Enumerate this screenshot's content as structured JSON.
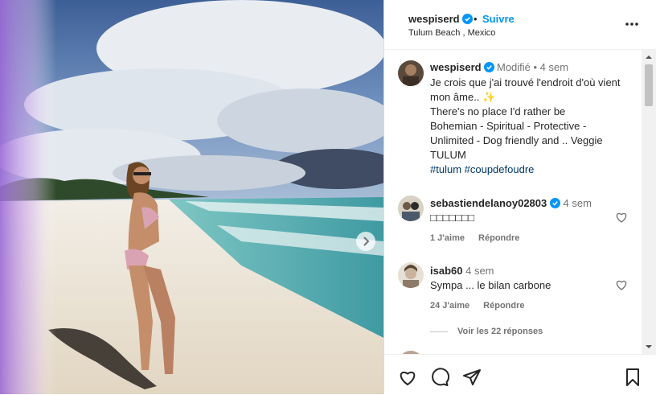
{
  "header": {
    "username": "wespiserd",
    "separator": "•",
    "follow_label": "Suivre",
    "location": "Tulum Beach , Mexico"
  },
  "caption": {
    "username": "wespiserd",
    "meta": "Modifié • 4 sem",
    "line1": "Je crois que j'ai trouvé l'endroit d'où vient mon âme.. ✨",
    "line2": "There's no place I'd rather be",
    "line3": "Bohemian - Spiritual - Protective - Unlimited - Dog friendly and .. Veggie TULUM",
    "hashtags": "#tulum #coupdefoudre"
  },
  "comments": [
    {
      "username": "sebastiendelanoy02803",
      "time": "4 sem",
      "text": "□□□□□□□",
      "likes": "1 J'aime",
      "reply_label": "Répondre"
    },
    {
      "username": "isab60",
      "time": "4 sem",
      "text": "Sympa ... le bilan carbone",
      "likes": "24 J'aime",
      "reply_label": "Répondre"
    }
  ],
  "view_replies_label": "Voir les 22 réponses",
  "colors": {
    "accent": "#0095f6",
    "text": "#262626",
    "muted": "#737373",
    "hashtag": "#00376b"
  },
  "icons": {
    "verified": "verified-badge-icon",
    "more": "more-options-icon",
    "like": "heart-icon",
    "comment": "comment-icon",
    "share": "share-icon",
    "save": "bookmark-icon",
    "next": "chevron-right-icon"
  }
}
